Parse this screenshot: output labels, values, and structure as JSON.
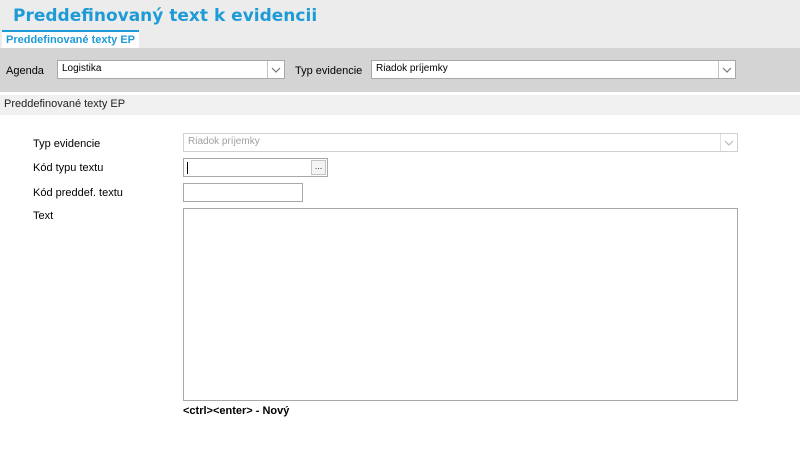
{
  "app": {
    "title": "Preddefinovaný text k evidencii",
    "active_tab": "Preddefinované texty EP"
  },
  "filter": {
    "agenda_label": "Agenda",
    "agenda_value": "Logistika",
    "typ_evidencie_label": "Typ evidencie",
    "typ_evidencie_value": "Riadok príjemky"
  },
  "section": {
    "title": "Preddefinované texty EP"
  },
  "form": {
    "typ_evidencie_label": "Typ evidencie",
    "typ_evidencie_value": "Riadok príjemky",
    "kod_typu_textu_label": "Kód typu textu",
    "kod_typu_textu_value": "",
    "kod_preddef_textu_label": "Kód preddef. textu",
    "kod_preddef_textu_value": "",
    "text_label": "Text",
    "text_value": "",
    "lookup_button": "...",
    "shortcut_hint": "<ctrl><enter> - Nový"
  },
  "colors": {
    "accent": "#1e9bd7",
    "title_bar_bg": "#ececec",
    "filter_bar_bg": "#d4d4d4",
    "section_bg": "#f0f0f0"
  },
  "icons": {
    "dropdown": "chevron-down-icon"
  }
}
